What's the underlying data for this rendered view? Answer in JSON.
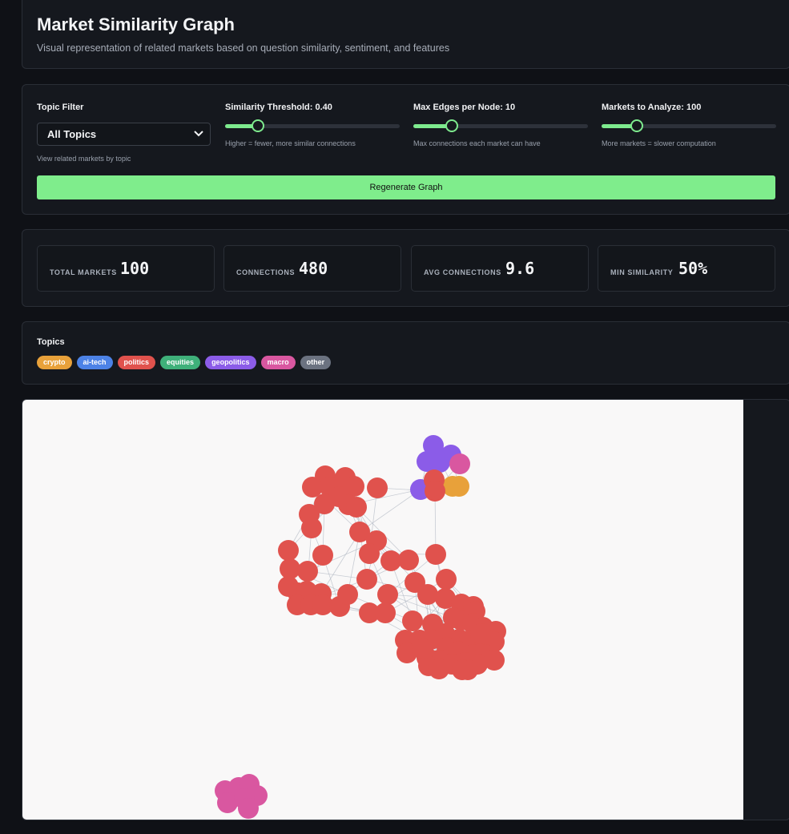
{
  "header": {
    "title": "Market Similarity Graph",
    "subtitle": "Visual representation of related markets based on question similarity, sentiment, and features"
  },
  "controls": {
    "topic_filter": {
      "label": "Topic Filter",
      "selected": "All Topics",
      "hint": "View related markets by topic"
    },
    "similarity_threshold": {
      "label": "Similarity Threshold: 0.40",
      "value": 0.4,
      "fraction": 0.19,
      "hint": "Higher = fewer, more similar connections"
    },
    "max_edges": {
      "label": "Max Edges per Node: 10",
      "value": 10,
      "fraction": 0.22,
      "hint": "Max connections each market can have"
    },
    "markets_to_analyze": {
      "label": "Markets to Analyze: 100",
      "value": 100,
      "fraction": 0.2,
      "hint": "More markets = slower computation"
    },
    "regenerate_label": "Regenerate Graph"
  },
  "stats": [
    {
      "label": "TOTAL MARKETS",
      "value": "100"
    },
    {
      "label": "CONNECTIONS",
      "value": "480"
    },
    {
      "label": "AVG CONNECTIONS",
      "value": "9.6"
    },
    {
      "label": "MIN SIMILARITY",
      "value": "50%"
    }
  ],
  "topics": {
    "title": "Topics",
    "items": [
      {
        "name": "crypto",
        "color": "#e8a13a"
      },
      {
        "name": "ai-tech",
        "color": "#4c82e6"
      },
      {
        "name": "politics",
        "color": "#e0524d"
      },
      {
        "name": "equities",
        "color": "#3fb07a"
      },
      {
        "name": "geopolitics",
        "color": "#8b5ce8"
      },
      {
        "name": "macro",
        "color": "#d957a0"
      },
      {
        "name": "other",
        "color": "#6b7280"
      }
    ]
  },
  "colors": {
    "accent": "#7eea8e",
    "edge": "#b8bec8",
    "canvas_bg": "#f9f8f8"
  }
}
